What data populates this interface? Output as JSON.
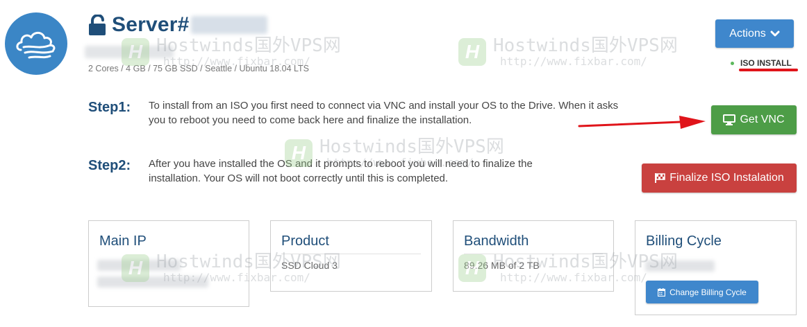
{
  "header": {
    "title": "Server#",
    "specs": "2 Cores / 4 GB / 75 GB SSD / Seattle / Ubuntu 18.04 LTS"
  },
  "actions": {
    "label": "Actions"
  },
  "status": {
    "label": "ISO INSTALL",
    "color": "#5cb85c"
  },
  "steps": [
    {
      "label": "Step1:",
      "text": "To install from an ISO you first need to connect via VNC and install your OS to the Drive. When it asks you to reboot you need to come back here and finalize the installation.",
      "button": "Get VNC"
    },
    {
      "label": "Step2:",
      "text": "After you have installed the OS and it prompts to reboot you will need to finalize the installation. Your OS will not boot correctly until this is completed.",
      "button": "Finalize ISO Instalation"
    }
  ],
  "cards": {
    "main_ip": {
      "title": "Main IP"
    },
    "product": {
      "title": "Product",
      "value": "SSD Cloud 3"
    },
    "bandwidth": {
      "title": "Bandwidth",
      "value": "89.26 MB of 2 TB"
    },
    "billing": {
      "title": "Billing Cycle",
      "button": "Change Billing Cycle"
    }
  },
  "watermark": {
    "brand": "Hostwinds国外VPS网",
    "url": "http://www.fixbar.com/",
    "badge": "H"
  },
  "colors": {
    "primary": "#3f87cc",
    "success": "#4d9d47",
    "danger": "#c9413f",
    "heading": "#1f4e79",
    "annotation": "#e0141a"
  },
  "icons": {
    "logo": "cloud-wind-icon",
    "title": "unlock-icon",
    "actions": "chevron-down-icon",
    "vnc": "monitor-icon",
    "finalize": "flag-checkered-icon",
    "billing": "calendar-icon"
  }
}
